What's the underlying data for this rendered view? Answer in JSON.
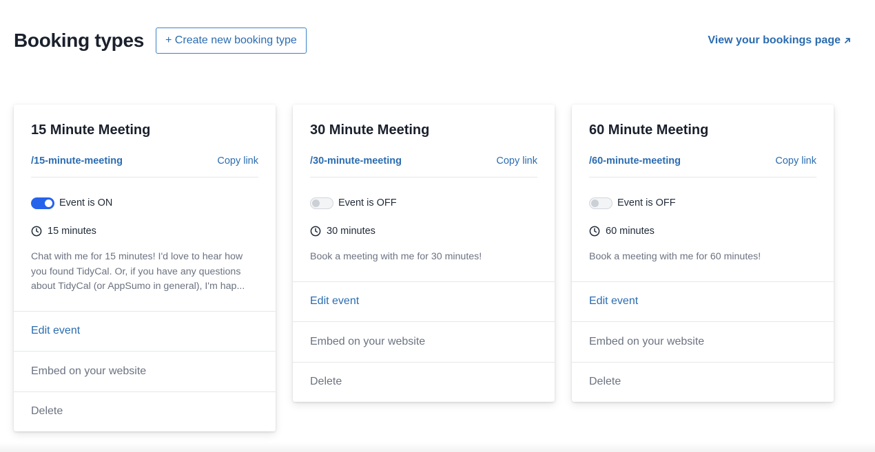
{
  "header": {
    "title": "Booking types",
    "create_button": "+ Create new booking type",
    "view_link": "View your bookings page"
  },
  "cards": [
    {
      "title": "15 Minute Meeting",
      "slug": "/15-minute-meeting",
      "copy_label": "Copy link",
      "status": "Event is ON",
      "toggle_on": true,
      "duration": "15 minutes",
      "description": "Chat with me for 15 minutes! I'd love to hear how you found TidyCal. Or, if you have any questions about TidyCal (or AppSumo in general), I'm hap...",
      "edit_label": "Edit event",
      "embed_label": "Embed on your website",
      "delete_label": "Delete"
    },
    {
      "title": "30 Minute Meeting",
      "slug": "/30-minute-meeting",
      "copy_label": "Copy link",
      "status": "Event is OFF",
      "toggle_on": false,
      "duration": "30 minutes",
      "description": "Book a meeting with me for 30 minutes!",
      "edit_label": "Edit event",
      "embed_label": "Embed on your website",
      "delete_label": "Delete"
    },
    {
      "title": "60 Minute Meeting",
      "slug": "/60-minute-meeting",
      "copy_label": "Copy link",
      "status": "Event is OFF",
      "toggle_on": false,
      "duration": "60 minutes",
      "description": "Book a meeting with me for 60 minutes!",
      "edit_label": "Edit event",
      "embed_label": "Embed on your website",
      "delete_label": "Delete"
    }
  ],
  "colors": {
    "accent": "#2b6cb0",
    "toggle_on": "#2563eb",
    "muted_text": "#6b7280"
  }
}
